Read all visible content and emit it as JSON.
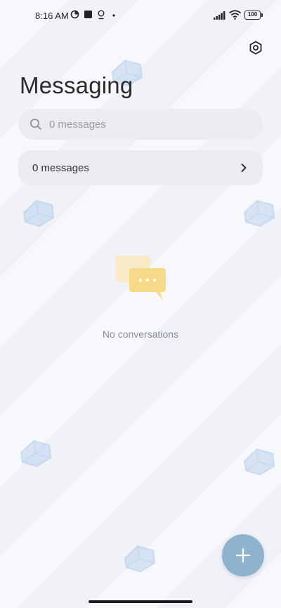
{
  "status_bar": {
    "time": "8:16 AM",
    "battery": "100",
    "icons": [
      "data-saver-icon",
      "square-notification-icon",
      "location-pin-icon",
      "dot-icon",
      "signal-icon",
      "wifi-icon",
      "battery-icon"
    ]
  },
  "header": {
    "title": "Messaging",
    "settings_icon": "settings-hexagon-icon"
  },
  "search": {
    "placeholder": "0 messages",
    "value": "",
    "icon": "search-icon"
  },
  "messages_row": {
    "label": "0 messages",
    "icon": "chevron-right-icon"
  },
  "empty_state": {
    "text": "No conversations",
    "icon": "chat-bubbles-icon"
  },
  "fab": {
    "icon": "plus-icon"
  },
  "colors": {
    "fab": "#8fb3cd",
    "row_bg": "#ececf0",
    "title": "#2b2b2b",
    "empty_text": "#8a8c94",
    "chat_illustration": "#f7d98a"
  }
}
